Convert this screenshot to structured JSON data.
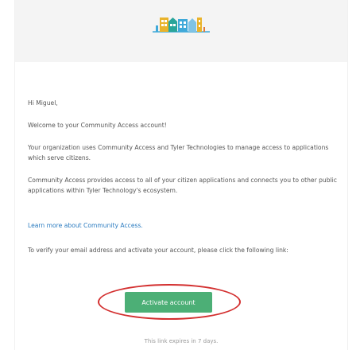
{
  "email": {
    "greeting": "Hi Miguel,",
    "welcome": "Welcome to your Community Access account!",
    "para1": "Your organization uses Community Access and Tyler Technologies to manage access to applications which serve citizens.",
    "para2": "Community Access provides access to all of your citizen applications and connects you to other public applications within Tyler Technology's ecosystem.",
    "learn_more_link": "Learn more about Community Access.",
    "verify_text": "To verify your email address and activate your account, please click the following link:",
    "cta_label": "Activate account",
    "expires_text": "This link expires in 7 days."
  },
  "icons": {
    "header": "community-buildings-logo-icon"
  },
  "colors": {
    "cta": "#4caf76",
    "link": "#2a7bc0",
    "highlight": "#d32f2f",
    "header_bg": "#f4f4f4"
  }
}
